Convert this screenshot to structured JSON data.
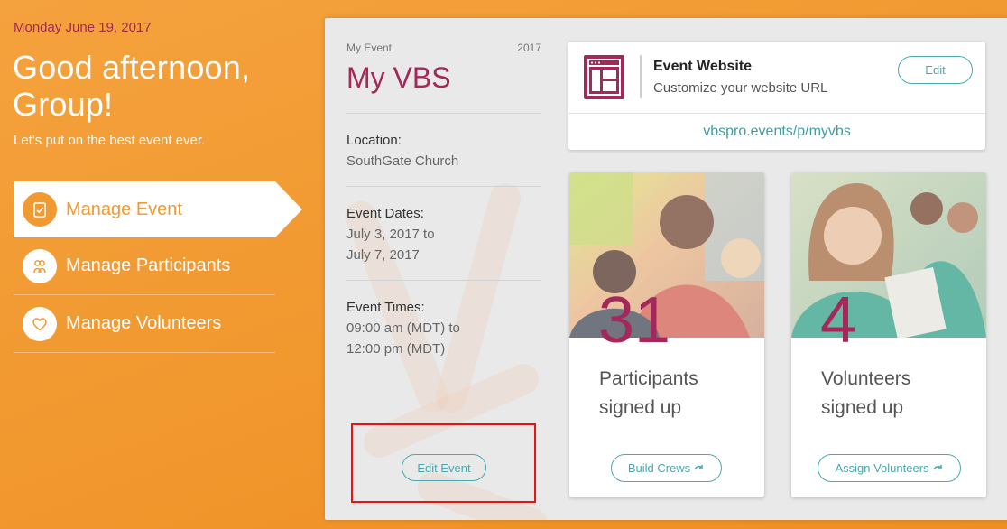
{
  "header": {
    "date": "Monday June 19, 2017",
    "greeting": "Good afternoon, Group!",
    "tagline": "Let's put on the best event ever."
  },
  "nav": {
    "items": [
      {
        "label": "Manage Event",
        "icon": "clipboard-check-icon",
        "active": true
      },
      {
        "label": "Manage Participants",
        "icon": "people-icon",
        "active": false
      },
      {
        "label": "Manage Volunteers",
        "icon": "heart-icon",
        "active": false
      }
    ]
  },
  "event": {
    "kicker": "My Event",
    "year": "2017",
    "title": "My VBS",
    "location_label": "Location:",
    "location_value": "SouthGate Church",
    "dates_label": "Event Dates:",
    "dates_line1": "July 3, 2017 to",
    "dates_line2": "July 7, 2017",
    "times_label": "Event Times:",
    "times_line1": "09:00 am (MDT) to",
    "times_line2": "12:00 pm (MDT)",
    "edit_label": "Edit Event"
  },
  "website": {
    "title": "Event Website",
    "subtitle": "Customize your website URL",
    "edit_label": "Edit",
    "url": "vbspro.events/p/myvbs",
    "icon": "layout-icon"
  },
  "stats": {
    "participants": {
      "count": "31",
      "line1": "Participants",
      "line2": "signed up",
      "button": "Build Crews"
    },
    "volunteers": {
      "count": "4",
      "line1": "Volunteers",
      "line2": "signed up",
      "button": "Assign Volunteers"
    }
  },
  "colors": {
    "accent": "#a4285a",
    "teal": "#4aa9b0",
    "orange": "#f29a32",
    "highlight": "#ee1111"
  }
}
